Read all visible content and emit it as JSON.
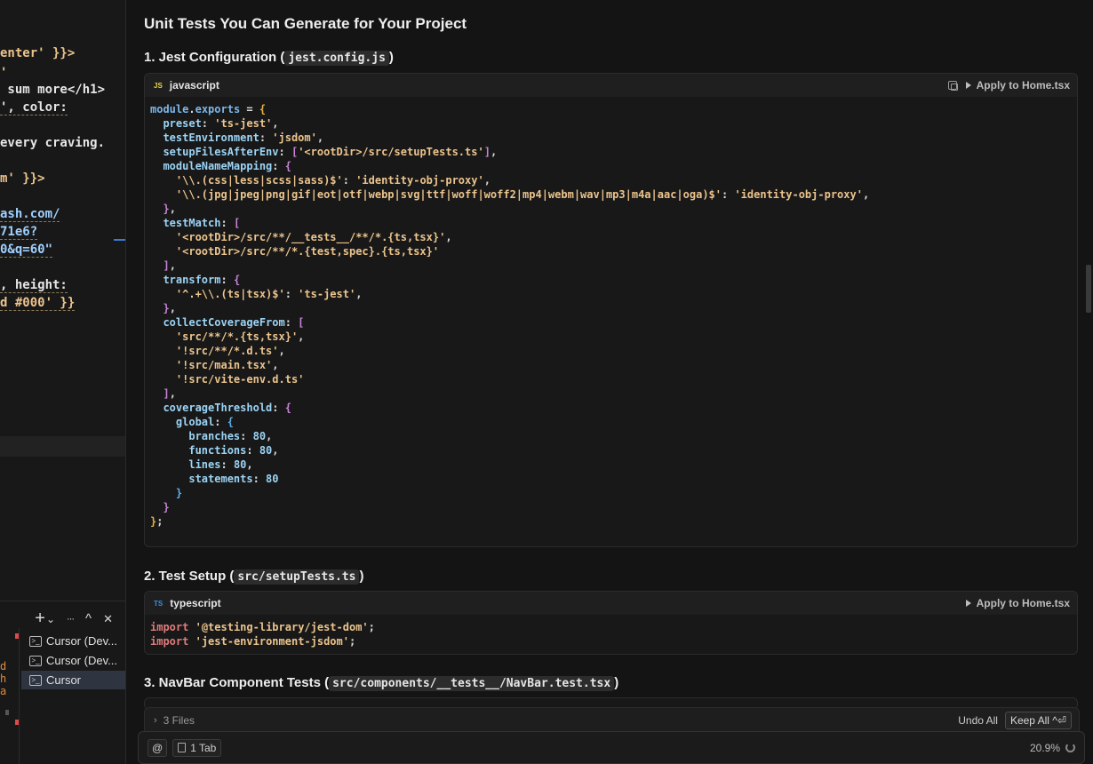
{
  "left_editor": {
    "lines": [
      {
        "text": "enter' }}>"
      },
      {
        "text": "'"
      },
      {
        "text": " sum more</h1>"
      },
      {
        "text": "', color:"
      },
      {
        "text": "every craving."
      },
      {
        "text": "m' }}>"
      },
      {
        "text": "ash.com/"
      },
      {
        "text": "71e6?"
      },
      {
        "text": "0&q=60\""
      },
      {
        "text": ", height:"
      },
      {
        "text": "d #000' }}"
      }
    ]
  },
  "terminal": {
    "toolbar": {
      "add_label": "+",
      "dropdown_label": "⌄",
      "more_label": "···",
      "maximize_label": "^",
      "close_label": "✕"
    },
    "gutter_letters": [
      "d",
      "h",
      "a"
    ],
    "items": [
      {
        "label": "Cursor (Dev..."
      },
      {
        "label": "Cursor (Dev..."
      },
      {
        "label": "Cursor"
      }
    ]
  },
  "chat": {
    "title": "Unit Tests You Can Generate for Your Project",
    "sections": [
      {
        "prefix": "1. Jest Configuration (",
        "code": "jest.config.js",
        "suffix": ")"
      },
      {
        "prefix": "2. Test Setup (",
        "code": "src/setupTests.ts",
        "suffix": ")"
      },
      {
        "prefix": "3. NavBar Component Tests (",
        "code": "src/components/__tests__/NavBar.test.tsx",
        "suffix": ")"
      }
    ],
    "blocks": [
      {
        "badge": "JS",
        "language": "javascript",
        "apply_label": "Apply to Home.tsx",
        "lines": [
          [
            [
              "k",
              "module"
            ],
            [
              "p",
              "."
            ],
            [
              "k",
              "exports"
            ],
            [
              "p",
              " = "
            ],
            [
              "b1",
              "{"
            ]
          ],
          [
            [
              "n",
              "  preset"
            ],
            [
              "p",
              ": "
            ],
            [
              "s",
              "'ts-jest'"
            ],
            [
              "p",
              ","
            ]
          ],
          [
            [
              "n",
              "  testEnvironment"
            ],
            [
              "p",
              ": "
            ],
            [
              "s",
              "'jsdom'"
            ],
            [
              "p",
              ","
            ]
          ],
          [
            [
              "n",
              "  setupFilesAfterEnv"
            ],
            [
              "p",
              ": "
            ],
            [
              "b2",
              "["
            ],
            [
              "s",
              "'<rootDir>/src/setupTests.ts'"
            ],
            [
              "b2",
              "]"
            ],
            [
              "p",
              ","
            ]
          ],
          [
            [
              "n",
              "  moduleNameMapping"
            ],
            [
              "p",
              ": "
            ],
            [
              "b2",
              "{"
            ]
          ],
          [
            [
              "s",
              "    '\\\\.(css|less|scss|sass)$'"
            ],
            [
              "p",
              ": "
            ],
            [
              "s",
              "'identity-obj-proxy'"
            ],
            [
              "p",
              ","
            ]
          ],
          [
            [
              "s",
              "    '\\\\.(jpg|jpeg|png|gif|eot|otf|webp|svg|ttf|woff|woff2|mp4|webm|wav|mp3|m4a|aac|oga)$'"
            ],
            [
              "p",
              ": "
            ],
            [
              "s",
              "'identity-obj-proxy'"
            ],
            [
              "p",
              ","
            ]
          ],
          [
            [
              "b2",
              "  }"
            ],
            [
              "p",
              ","
            ]
          ],
          [
            [
              "n",
              "  testMatch"
            ],
            [
              "p",
              ": "
            ],
            [
              "b2",
              "["
            ]
          ],
          [
            [
              "s",
              "    '<rootDir>/src/**/__tests__/**/*.{ts,tsx}'"
            ],
            [
              "p",
              ","
            ]
          ],
          [
            [
              "s",
              "    '<rootDir>/src/**/*.{test,spec}.{ts,tsx}'"
            ]
          ],
          [
            [
              "b2",
              "  ]"
            ],
            [
              "p",
              ","
            ]
          ],
          [
            [
              "n",
              "  transform"
            ],
            [
              "p",
              ": "
            ],
            [
              "b2",
              "{"
            ]
          ],
          [
            [
              "s",
              "    '^.+\\\\.(ts|tsx)$'"
            ],
            [
              "p",
              ": "
            ],
            [
              "s",
              "'ts-jest'"
            ],
            [
              "p",
              ","
            ]
          ],
          [
            [
              "b2",
              "  }"
            ],
            [
              "p",
              ","
            ]
          ],
          [
            [
              "n",
              "  collectCoverageFrom"
            ],
            [
              "p",
              ": "
            ],
            [
              "b2",
              "["
            ]
          ],
          [
            [
              "s",
              "    'src/**/*.{ts,tsx}'"
            ],
            [
              "p",
              ","
            ]
          ],
          [
            [
              "s",
              "    '!src/**/*.d.ts'"
            ],
            [
              "p",
              ","
            ]
          ],
          [
            [
              "s",
              "    '!src/main.tsx'"
            ],
            [
              "p",
              ","
            ]
          ],
          [
            [
              "s",
              "    '!src/vite-env.d.ts'"
            ]
          ],
          [
            [
              "b2",
              "  ]"
            ],
            [
              "p",
              ","
            ]
          ],
          [
            [
              "n",
              "  coverageThreshold"
            ],
            [
              "p",
              ": "
            ],
            [
              "b2",
              "{"
            ]
          ],
          [
            [
              "n",
              "    global"
            ],
            [
              "p",
              ": "
            ],
            [
              "b3",
              "{"
            ]
          ],
          [
            [
              "n",
              "      branches"
            ],
            [
              "p",
              ": "
            ],
            [
              "n",
              "80"
            ],
            [
              "p",
              ","
            ]
          ],
          [
            [
              "n",
              "      functions"
            ],
            [
              "p",
              ": "
            ],
            [
              "n",
              "80"
            ],
            [
              "p",
              ","
            ]
          ],
          [
            [
              "n",
              "      lines"
            ],
            [
              "p",
              ": "
            ],
            [
              "n",
              "80"
            ],
            [
              "p",
              ","
            ]
          ],
          [
            [
              "n",
              "      statements"
            ],
            [
              "p",
              ": "
            ],
            [
              "n",
              "80"
            ]
          ],
          [
            [
              "b3",
              "    }"
            ]
          ],
          [
            [
              "b2",
              "  }"
            ]
          ],
          [
            [
              "b1",
              "}"
            ],
            [
              "p",
              ";"
            ]
          ]
        ]
      },
      {
        "badge": "TS",
        "language": "typescript",
        "apply_label": "Apply to Home.tsx",
        "lines": [
          [
            [
              "kw",
              "import"
            ],
            [
              "p",
              " "
            ],
            [
              "s",
              "'@testing-library/jest-dom'"
            ],
            [
              "p",
              ";"
            ]
          ],
          [
            [
              "kw",
              "import"
            ],
            [
              "p",
              " "
            ],
            [
              "s",
              "'jest-environment-jsdom'"
            ],
            [
              "p",
              ";"
            ]
          ]
        ]
      }
    ]
  },
  "composer": {
    "files_label": "3 Files",
    "undo_all_label": "Undo All",
    "keep_all_label": "Keep All ^⏎",
    "at_label": "@",
    "tab_chip_label": "1 Tab",
    "usage_label": "20.9%"
  }
}
